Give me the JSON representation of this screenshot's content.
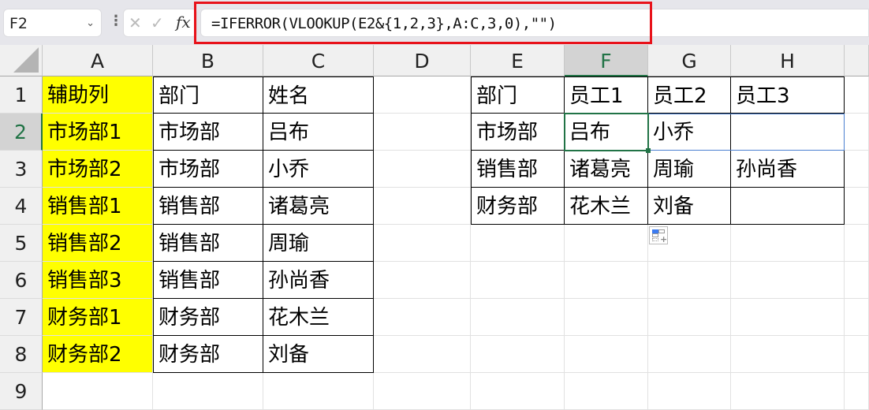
{
  "formula_bar": {
    "name_box": "F2",
    "cancel_icon": "✕",
    "confirm_icon": "✓",
    "fx_label": "fx",
    "formula": "=IFERROR(VLOOKUP(E2&{1,2,3},A:C,3,0),\"\")"
  },
  "columns": [
    "A",
    "B",
    "C",
    "D",
    "E",
    "F",
    "G",
    "H"
  ],
  "rows": [
    "1",
    "2",
    "3",
    "4",
    "5",
    "6",
    "7",
    "8",
    "9"
  ],
  "selected_cell": "F2",
  "colors": {
    "helper_fill": "#ffff00",
    "selection": "#217346",
    "highlight_box": "#e8121a",
    "spill_border": "#4a7fd0"
  },
  "source_table": {
    "A": [
      "辅助列",
      "市场部1",
      "市场部2",
      "销售部1",
      "销售部2",
      "销售部3",
      "财务部1",
      "财务部2"
    ],
    "B": [
      "部门",
      "市场部",
      "市场部",
      "销售部",
      "销售部",
      "销售部",
      "财务部",
      "财务部"
    ],
    "C": [
      "姓名",
      "吕布",
      "小乔",
      "诸葛亮",
      "周瑜",
      "孙尚香",
      "花木兰",
      "刘备"
    ]
  },
  "result_table": {
    "headers": [
      "部门",
      "员工1",
      "员工2",
      "员工3"
    ],
    "rows": [
      [
        "市场部",
        "吕布",
        "小乔",
        ""
      ],
      [
        "销售部",
        "诸葛亮",
        "周瑜",
        "孙尚香"
      ],
      [
        "财务部",
        "花木兰",
        "刘备",
        ""
      ]
    ]
  }
}
